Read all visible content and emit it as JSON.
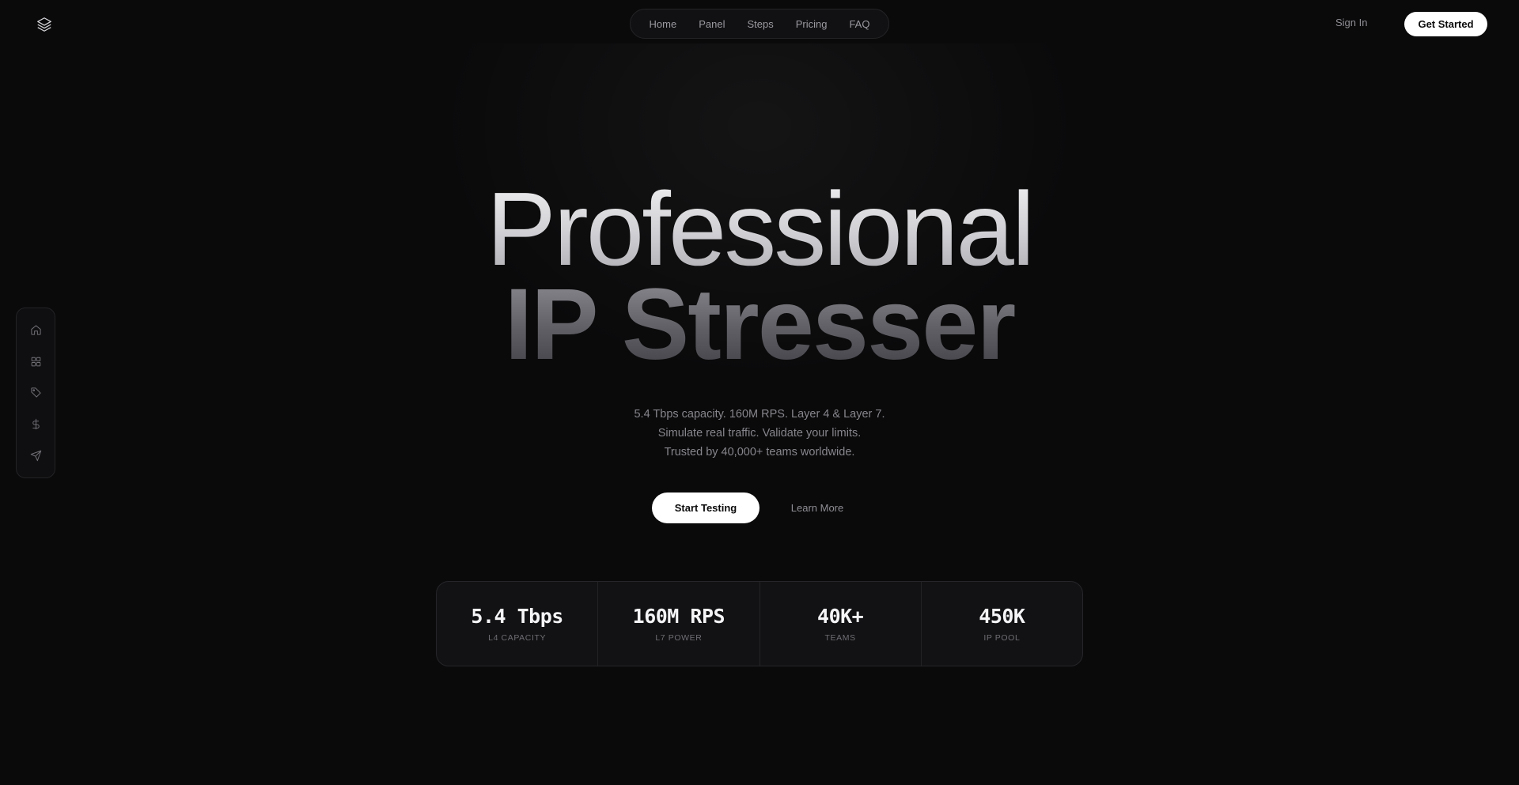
{
  "header": {
    "logo_icon": "layers-icon",
    "nav": [
      "Home",
      "Panel",
      "Steps",
      "Pricing",
      "FAQ"
    ],
    "sign_in": "Sign In",
    "get_started": "Get Started"
  },
  "sidebar": {
    "items": [
      {
        "icon": "home-icon"
      },
      {
        "icon": "grid-icon"
      },
      {
        "icon": "tag-icon"
      },
      {
        "icon": "dollar-icon"
      },
      {
        "icon": "send-icon"
      }
    ]
  },
  "hero": {
    "title_line1": "Professional",
    "title_line2": "IP Stresser",
    "subtitle_lines": [
      "5.4 Tbps capacity. 160M RPS. Layer 4 & Layer 7.",
      "Simulate real traffic. Validate your limits.",
      "Trusted by 40,000+ teams worldwide."
    ],
    "primary_cta": "Start Testing",
    "secondary_cta": "Learn More"
  },
  "stats": [
    {
      "value": "5.4 Tbps",
      "label": "L4 CAPACITY"
    },
    {
      "value": "160M RPS",
      "label": "L7 POWER"
    },
    {
      "value": "40K+",
      "label": "TEAMS"
    },
    {
      "value": "450K",
      "label": "IP POOL"
    }
  ],
  "colors": {
    "background": "#0a0a0b",
    "accent": "#ffffff",
    "muted_text": "#86868c"
  }
}
